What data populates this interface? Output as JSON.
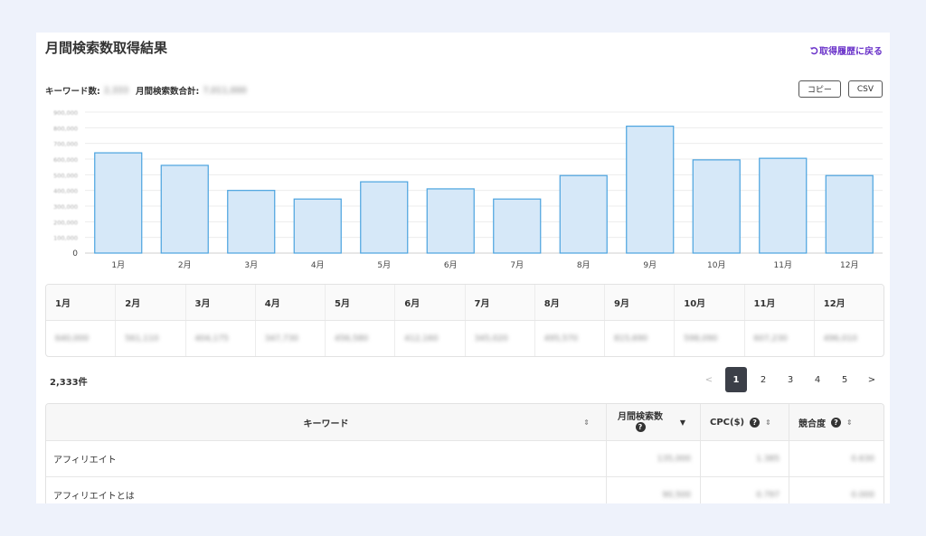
{
  "header": {
    "title": "月間検索数取得結果",
    "back_label": "取得履歴に戻る"
  },
  "summary": {
    "keyword_count_label": "キーワード数:",
    "keyword_count_value": "2,333",
    "total_volume_label": "月間検索数合計:",
    "total_volume_value": "7,011,000"
  },
  "actions": {
    "copy_label": "コピー",
    "csv_label": "CSV"
  },
  "chart_data": {
    "type": "bar",
    "categories": [
      "1月",
      "2月",
      "3月",
      "4月",
      "5月",
      "6月",
      "7月",
      "8月",
      "9月",
      "10月",
      "11月",
      "12月"
    ],
    "values": [
      640000,
      560000,
      400000,
      345000,
      455000,
      410000,
      345000,
      495000,
      810000,
      595000,
      605000,
      495000
    ],
    "y_ticks": [
      "0",
      "100,000",
      "200,000",
      "300,000",
      "400,000",
      "500,000",
      "600,000",
      "700,000",
      "800,000",
      "900,000"
    ],
    "ylim": [
      0,
      900000
    ],
    "grid": true,
    "bar_fill": "#d6e8f8",
    "bar_stroke": "#4aa3df"
  },
  "monthly_table": {
    "months": [
      "1月",
      "2月",
      "3月",
      "4月",
      "5月",
      "6月",
      "7月",
      "8月",
      "9月",
      "10月",
      "11月",
      "12月"
    ],
    "values": [
      "640,000",
      "561,110",
      "404,175",
      "347,730",
      "456,580",
      "412,160",
      "345,020",
      "495,570",
      "815,690",
      "598,090",
      "607,230",
      "496,010"
    ]
  },
  "results": {
    "count_label": "2,333件"
  },
  "pagination": {
    "prev": "<",
    "pages": [
      "1",
      "2",
      "3",
      "4",
      "5"
    ],
    "current": "1",
    "next": ">"
  },
  "keyword_table": {
    "headers": {
      "keyword": "キーワード",
      "volume": "月間検索数",
      "cpc": "CPC($)",
      "competition": "競合度"
    },
    "help_icon": "?",
    "rows": [
      {
        "keyword": "アフィリエイト",
        "volume": "135,000",
        "cpc": "1.385",
        "competition": "0.630"
      },
      {
        "keyword": "アフィリエイトとは",
        "volume": "90,500",
        "cpc": "0.797",
        "competition": "0.000"
      }
    ]
  }
}
